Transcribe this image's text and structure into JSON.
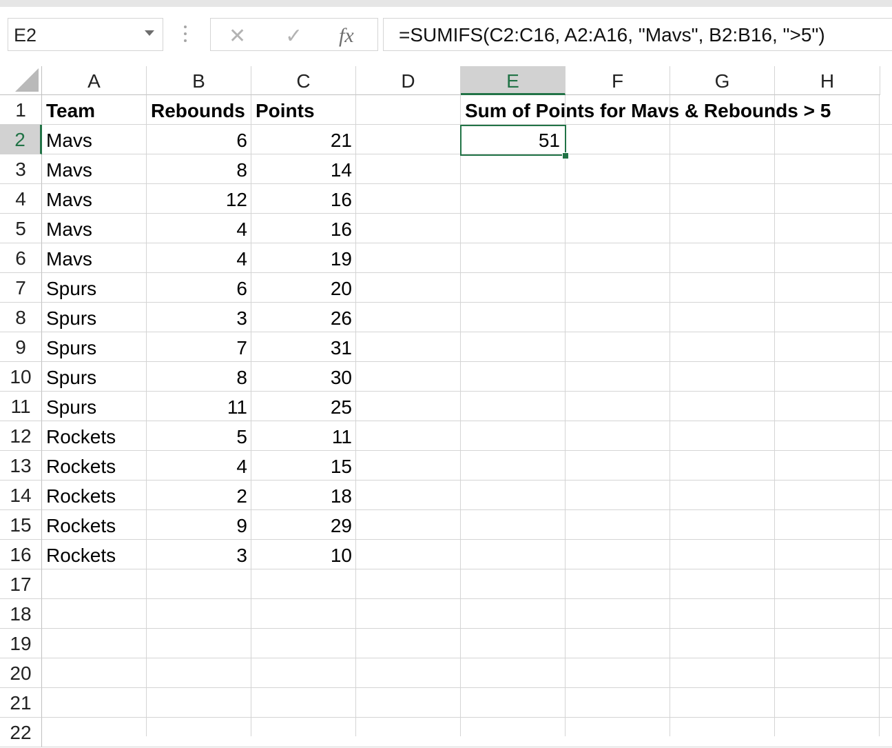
{
  "name_box": {
    "value": "E2"
  },
  "formula_bar": {
    "cancel_glyph": "✕",
    "enter_glyph": "✓",
    "function_glyph": "fx",
    "formula": "=SUMIFS(C2:C16, A2:A16, \"Mavs\", B2:B16, \">5\")"
  },
  "columns": [
    "A",
    "B",
    "C",
    "D",
    "E",
    "F",
    "G",
    "H"
  ],
  "selected_column": "E",
  "rows": [
    "1",
    "2",
    "3",
    "4",
    "5",
    "6",
    "7",
    "8",
    "9",
    "10",
    "11",
    "12",
    "13",
    "14",
    "15",
    "16",
    "17",
    "18",
    "19",
    "20",
    "21",
    "22"
  ],
  "selected_row": "2",
  "header": {
    "team": "Team",
    "rebounds": "Rebounds",
    "points": "Points",
    "e1": "Sum of Points for Mavs & Rebounds > 5"
  },
  "data": [
    {
      "team": "Mavs",
      "rebounds": "6",
      "points": "21"
    },
    {
      "team": "Mavs",
      "rebounds": "8",
      "points": "14"
    },
    {
      "team": "Mavs",
      "rebounds": "12",
      "points": "16"
    },
    {
      "team": "Mavs",
      "rebounds": "4",
      "points": "16"
    },
    {
      "team": "Mavs",
      "rebounds": "4",
      "points": "19"
    },
    {
      "team": "Spurs",
      "rebounds": "6",
      "points": "20"
    },
    {
      "team": "Spurs",
      "rebounds": "3",
      "points": "26"
    },
    {
      "team": "Spurs",
      "rebounds": "7",
      "points": "31"
    },
    {
      "team": "Spurs",
      "rebounds": "8",
      "points": "30"
    },
    {
      "team": "Spurs",
      "rebounds": "11",
      "points": "25"
    },
    {
      "team": "Rockets",
      "rebounds": "5",
      "points": "11"
    },
    {
      "team": "Rockets",
      "rebounds": "4",
      "points": "15"
    },
    {
      "team": "Rockets",
      "rebounds": "2",
      "points": "18"
    },
    {
      "team": "Rockets",
      "rebounds": "9",
      "points": "29"
    },
    {
      "team": "Rockets",
      "rebounds": "3",
      "points": "10"
    }
  ],
  "result": {
    "e2": "51"
  },
  "colors": {
    "accent": "#217346",
    "header_selected_bg": "#d2d2d2",
    "gridline": "#d4d4d4"
  }
}
